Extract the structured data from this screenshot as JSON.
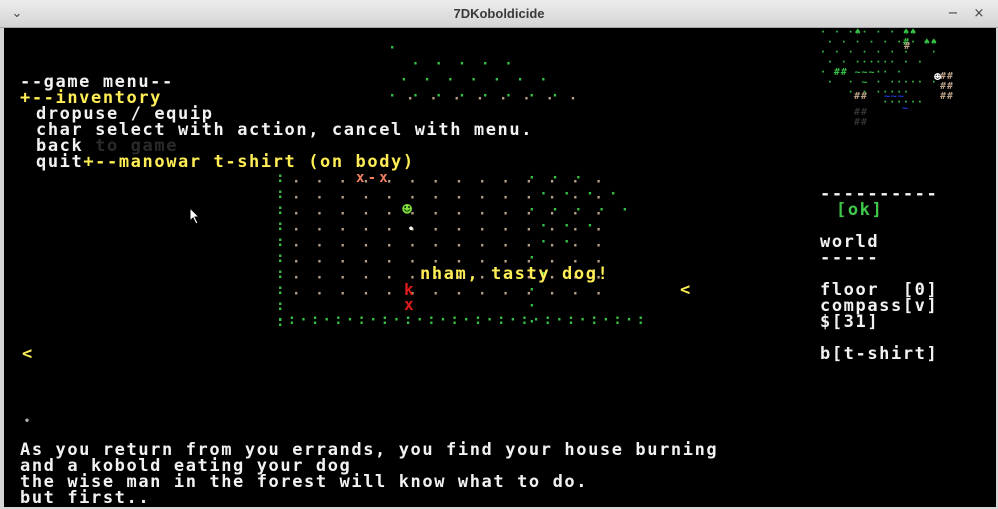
{
  "window": {
    "title": "7DKoboldicide",
    "menu_glyph": "⌄",
    "minimize_glyph": "−",
    "close_glyph": "×"
  },
  "game_menu": {
    "header": "--game menu--",
    "inventory": "+--inventory",
    "drop_use_equip": "dropuse / equip",
    "hint": "char select with action, cancel with menu.",
    "back": "back",
    "back_ghost": " to game",
    "quit": "quit",
    "item": "+--manowar t-shirt (on body)"
  },
  "map": {
    "rows": [
      "          ·   ·        ",
      "   ··x-x··········     ",
      "   ·····:····· ·       ",
      "   ·········☻···       ",
      "   ·········•···       ",
      "   ·········ʹ···       ",
      "   ·············       ",
      "   ·········k···       ",
      "   ·········x···       "
    ],
    "player_glyph": "☻",
    "enemy_glyph": "k",
    "blood_glyph": "x"
  },
  "speech": "nham, tasty dog!",
  "markers": {
    "right_arrow": "<",
    "left_arrow": "<",
    "small_dot": "•"
  },
  "sidebar": {
    "divider": "----------",
    "ok": "[ok]",
    "world_label": "world",
    "world_underline": "-----",
    "floor": "floor  [0]",
    "compass": "compass[v]",
    "money": "$[31]",
    "equipped": "b[t-shirt]"
  },
  "message_log": [
    "As you return from you errands, you find your house burning",
    "and a kobold eating your dog",
    "the wise man in the forest will know what to do.",
    "but first.."
  ],
  "colors": {
    "text": "#f2f2f2",
    "highlight": "#ffee55",
    "grass": "#3fc94a",
    "floor_dots": "#b89f85",
    "kobold": "#e01b1b",
    "player": "#7ee03a",
    "blood": "#f08060",
    "water": "#1f3df0"
  }
}
